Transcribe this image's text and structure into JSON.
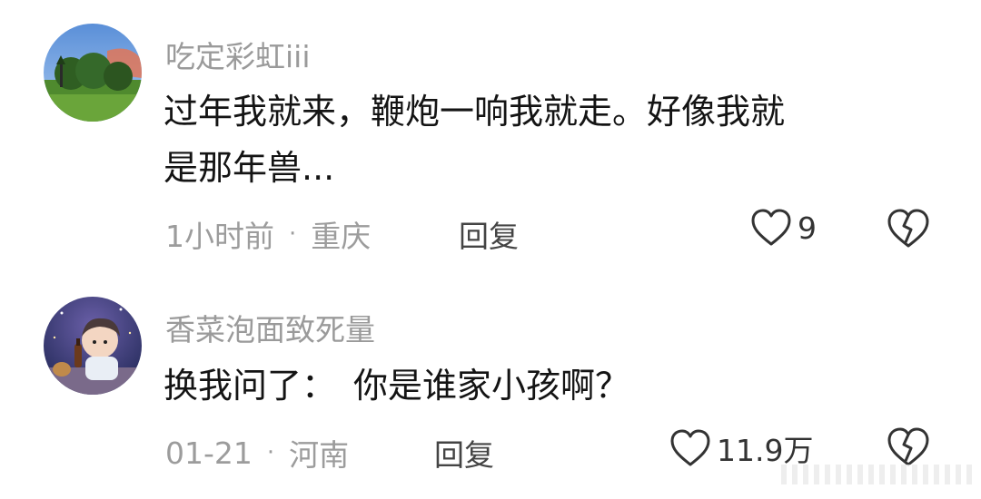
{
  "comments": [
    {
      "username": "吃定彩虹iii",
      "text_line1": "过年我就来，鞭炮一响我就走。好像我就",
      "text_line2": "是那年兽...",
      "time": "1小时前",
      "separator": "·",
      "location": "重庆",
      "reply_label": "回复",
      "like_count": "9",
      "avatar_icon": "landscape-avatar",
      "like_icon": "heart-outline-icon",
      "dislike_icon": "broken-heart-icon"
    },
    {
      "username": "香菜泡面致死量",
      "text": "换我问了：　你是谁家小孩啊？",
      "time": "01-21",
      "separator": "·",
      "location": "河南",
      "reply_label": "回复",
      "like_count": "11.9万",
      "avatar_icon": "anime-child-avatar",
      "like_icon": "heart-outline-icon",
      "dislike_icon": "broken-heart-icon"
    }
  ],
  "colors": {
    "username": "#9a9a9a",
    "body": "#141414",
    "meta": "#9c9c9c",
    "icon": "#333333"
  }
}
